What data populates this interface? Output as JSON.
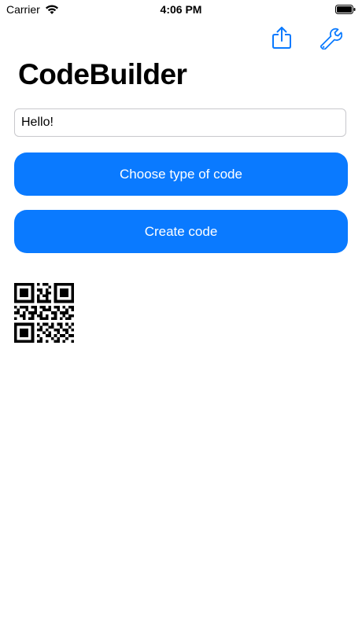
{
  "status_bar": {
    "carrier": "Carrier",
    "time": "4:06 PM"
  },
  "nav": {
    "icons": [
      "share-icon",
      "wrench-icon"
    ],
    "accent_color": "#0a7aff"
  },
  "title": "CodeBuilder",
  "input": {
    "value": "Hello!",
    "placeholder": ""
  },
  "buttons": {
    "choose_type": "Choose type of code",
    "create": "Create code"
  },
  "qr_code": {
    "icon": "qr-code"
  },
  "colors": {
    "button_bg": "#0a7aff",
    "button_text": "#ffffff",
    "background": "#ffffff"
  }
}
